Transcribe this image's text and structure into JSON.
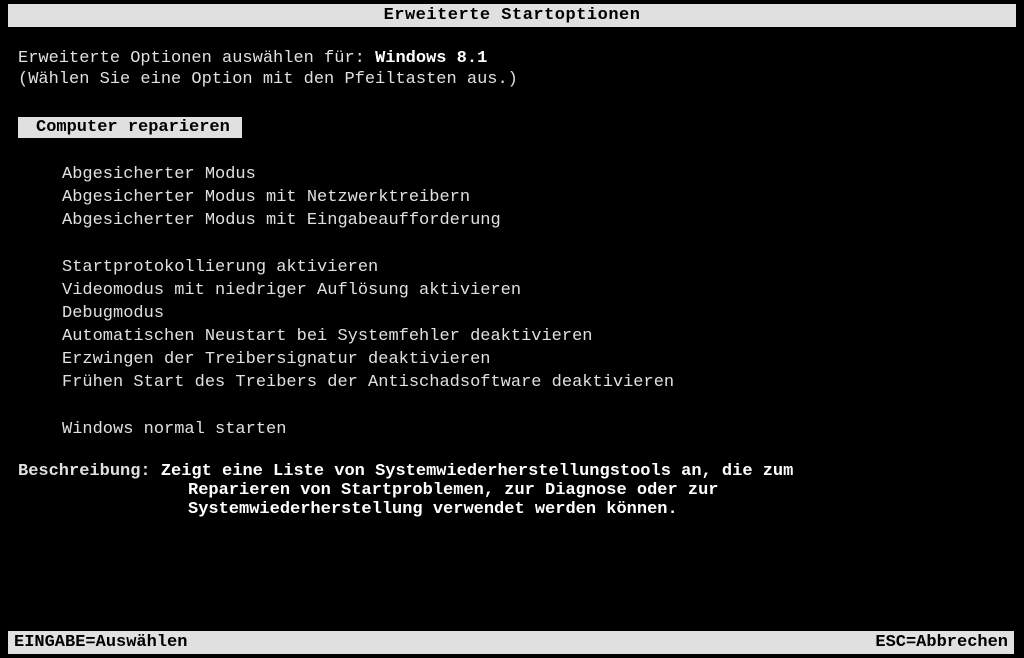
{
  "title": "Erweiterte Startoptionen",
  "prompt": {
    "label": "Erweiterte Optionen auswählen für:",
    "os": "Windows 8.1"
  },
  "hint": "(Wählen Sie eine Option mit den Pfeiltasten aus.)",
  "menu": {
    "groups": [
      {
        "items": [
          {
            "label": "Computer reparieren",
            "selected": true
          }
        ]
      },
      {
        "items": [
          {
            "label": "Abgesicherter Modus",
            "selected": false
          },
          {
            "label": "Abgesicherter Modus mit Netzwerktreibern",
            "selected": false
          },
          {
            "label": "Abgesicherter Modus mit Eingabeaufforderung",
            "selected": false
          }
        ]
      },
      {
        "items": [
          {
            "label": "Startprotokollierung aktivieren",
            "selected": false
          },
          {
            "label": "Videomodus mit niedriger Auflösung aktivieren",
            "selected": false
          },
          {
            "label": "Debugmodus",
            "selected": false
          },
          {
            "label": "Automatischen Neustart bei Systemfehler deaktivieren",
            "selected": false
          },
          {
            "label": "Erzwingen der Treibersignatur deaktivieren",
            "selected": false
          },
          {
            "label": "Frühen Start des Treibers der Antischadsoftware deaktivieren",
            "selected": false
          }
        ]
      },
      {
        "items": [
          {
            "label": "Windows normal starten",
            "selected": false
          }
        ]
      }
    ]
  },
  "description": {
    "label": "Beschreibung:",
    "line1": "Zeigt eine Liste von Systemwiederherstellungstools an, die zum",
    "line2": "Reparieren von Startproblemen, zur Diagnose oder zur",
    "line3": "Systemwiederherstellung verwendet werden können."
  },
  "footer": {
    "select": "EINGABE=Auswählen",
    "cancel": "ESC=Abbrechen"
  }
}
